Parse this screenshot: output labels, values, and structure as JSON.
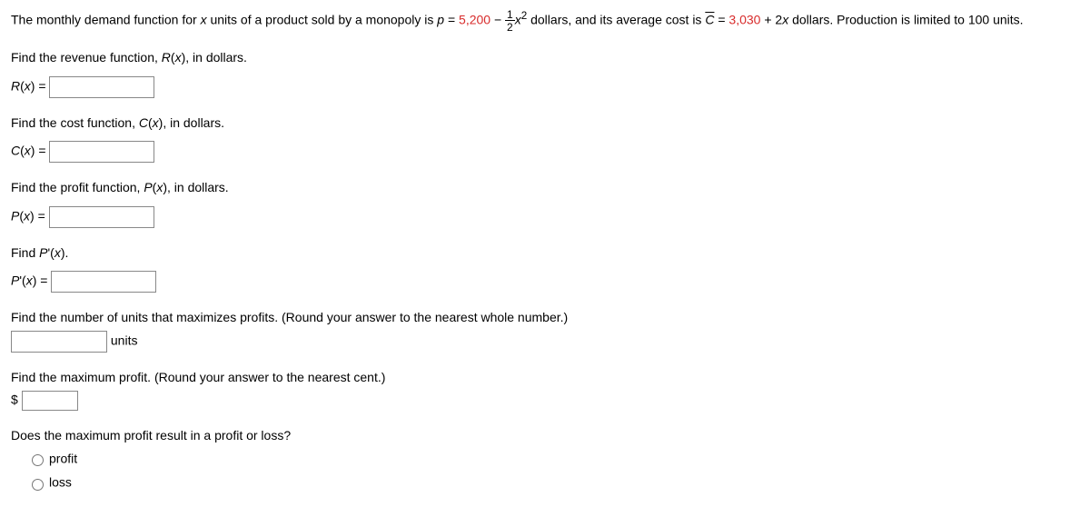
{
  "intro": {
    "t1": "The monthly demand function for ",
    "xvar": "x",
    "t2": " units of a product sold by a monopoly is ",
    "pvar": "p",
    "eq1": " = ",
    "c1": "5,200",
    "minus": " − ",
    "frac_num": "1",
    "frac_den": "2",
    "xsq_x": "x",
    "xsq_exp": "2",
    "t3": " dollars, and its average cost is ",
    "cbar": "C",
    "eq2": " = ",
    "c2": "3,030",
    "t4": " + 2",
    "xvar2": "x",
    "t5": " dollars. Production is limited to 100 units."
  },
  "q1": {
    "prompt1": "Find the revenue function, ",
    "func": "R",
    "paren_open": "(",
    "xvar": "x",
    "paren_close": ")",
    "prompt2": ", in dollars.",
    "lhs_func": "R",
    "lhs_open": "(",
    "lhs_x": "x",
    "lhs_close": ") = "
  },
  "q2": {
    "prompt1": "Find the cost function, ",
    "func": "C",
    "paren_open": "(",
    "xvar": "x",
    "paren_close": ")",
    "prompt2": ", in dollars.",
    "lhs_func": "C",
    "lhs_open": "(",
    "lhs_x": "x",
    "lhs_close": ") = "
  },
  "q3": {
    "prompt1": "Find the profit function, ",
    "func": "P",
    "paren_open": "(",
    "xvar": "x",
    "paren_close": ")",
    "prompt2": ", in dollars.",
    "lhs_func": "P",
    "lhs_open": "(",
    "lhs_x": "x",
    "lhs_close": ") = "
  },
  "q4": {
    "prompt1": "Find ",
    "func": "P",
    "prime": "'",
    "paren_open": "(",
    "xvar": "x",
    "paren_close": ").",
    "lhs_func": "P",
    "lhs_prime": "'",
    "lhs_open": "(",
    "lhs_x": "x",
    "lhs_close": ") = "
  },
  "q5": {
    "prompt": "Find the number of units that maximizes profits. (Round your answer to the nearest whole number.)",
    "unit": "units"
  },
  "q6": {
    "prompt": "Find the maximum profit. (Round your answer to the nearest cent.)",
    "currency": "$"
  },
  "q7": {
    "prompt": "Does the maximum profit result in a profit or loss?",
    "opt1": "profit",
    "opt2": "loss"
  }
}
